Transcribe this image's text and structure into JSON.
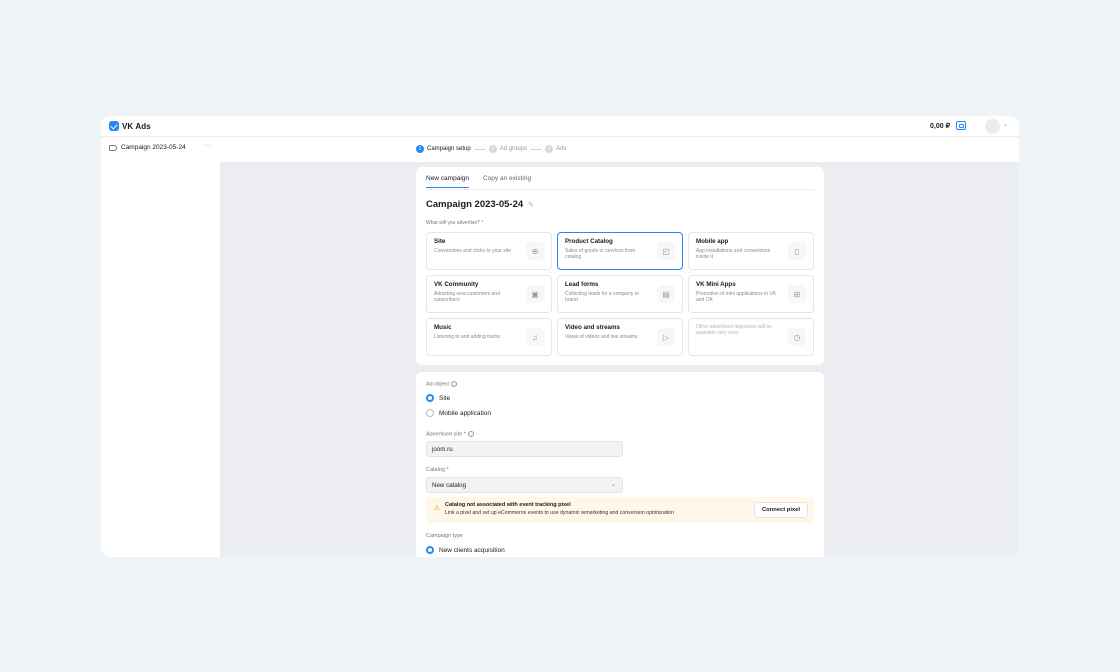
{
  "app": {
    "name": "VK Ads"
  },
  "header": {
    "balance": "0,00 ₽"
  },
  "subbar": {
    "campaign_name": "Campaign 2023-05-24",
    "more": "···",
    "steps": [
      {
        "num": "1",
        "label": "Campaign setup"
      },
      {
        "num": "2",
        "label": "Ad groups"
      },
      {
        "num": "3",
        "label": "Ads"
      }
    ]
  },
  "tabs": [
    "New campaign",
    "Copy an existing"
  ],
  "campaign": {
    "title": "Campaign 2023-05-24",
    "question": "What will you advertise?",
    "required_mark": "*"
  },
  "objectives": [
    {
      "name": "Site",
      "desc": "Conversions and clicks to your site",
      "icon": "globe-icon",
      "glyph": "⊕"
    },
    {
      "name": "Product Catalog",
      "desc": "Sales of goods or services from catalog",
      "icon": "bag-icon",
      "glyph": "◰"
    },
    {
      "name": "Mobile app",
      "desc": "App installations and conversions inside it",
      "icon": "phone-icon",
      "glyph": "▯"
    },
    {
      "name": "VK Community",
      "desc": "Attracting new customers and subscribers",
      "icon": "vk-icon",
      "glyph": "▣"
    },
    {
      "name": "Lead forms",
      "desc": "Collecting leads for a company or brand",
      "icon": "form-icon",
      "glyph": "▤"
    },
    {
      "name": "VK Mini Apps",
      "desc": "Promotion of mini applications in VK and OK",
      "icon": "grid-icon",
      "glyph": "⊞"
    },
    {
      "name": "Music",
      "desc": "Listening to and adding tracks",
      "icon": "music-icon",
      "glyph": "♫"
    },
    {
      "name": "Video and streams",
      "desc": "Views of videos and live streams",
      "icon": "play-icon",
      "glyph": "▷"
    },
    {
      "name": "",
      "desc": "Other advertised objectives will be available very soon",
      "icon": "clock-icon",
      "glyph": "◷"
    }
  ],
  "ad_object": {
    "label": "Ad object",
    "options": [
      "Site",
      "Mobile application"
    ],
    "selected": "Site"
  },
  "advertised_site": {
    "label": "Advertised site",
    "value": "joom.ru"
  },
  "catalog": {
    "label": "Catalog",
    "value": "New catalog"
  },
  "warning": {
    "title": "Catalog not associated with event tracking pixel",
    "text": "Link a pixel and set up eCommerce events to use dynamic remarketing and conversion optimization",
    "button": "Connect pixel"
  },
  "campaign_type": {
    "label": "Campaign type",
    "option": "New clients acquisition"
  },
  "colors": {
    "accent": "#2787f5",
    "warning_bg": "#fff8e9",
    "content_bg": "#ebedf0"
  }
}
